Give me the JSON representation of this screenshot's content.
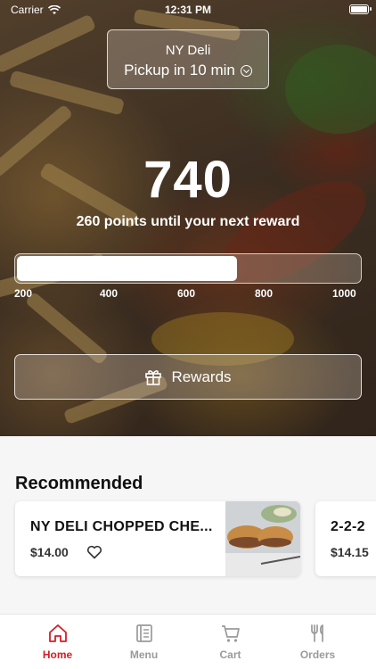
{
  "status_bar": {
    "carrier": "Carrier",
    "time": "12:31 PM"
  },
  "location": {
    "name": "NY Deli",
    "mode": "Pickup in 10 min"
  },
  "loyalty": {
    "points": "740",
    "caption": "260 points until your next reward",
    "progress_fraction": 0.64,
    "ticks": [
      "200",
      "400",
      "600",
      "800",
      "1000"
    ]
  },
  "rewards_button": {
    "label": "Rewards",
    "icon": "gift-icon"
  },
  "recommended": {
    "title": "Recommended",
    "items": [
      {
        "name": "NY DELI CHOPPED CHE...",
        "price": "$14.00"
      },
      {
        "name": "2-2-2",
        "price": "$14.15"
      }
    ]
  },
  "tabs": [
    {
      "label": "Home",
      "icon": "home-icon",
      "active": true
    },
    {
      "label": "Menu",
      "icon": "menu-icon",
      "active": false
    },
    {
      "label": "Cart",
      "icon": "cart-icon",
      "active": false
    },
    {
      "label": "Orders",
      "icon": "utensils-icon",
      "active": false
    }
  ],
  "colors": {
    "accent": "#d21f26",
    "tab_inactive": "#9a9a9a"
  }
}
